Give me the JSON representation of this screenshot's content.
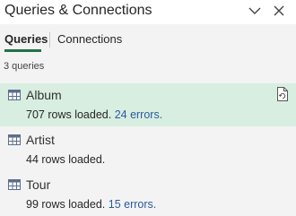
{
  "pane": {
    "title": "Queries & Connections"
  },
  "tabs": [
    {
      "label": "Queries",
      "active": true
    },
    {
      "label": "Connections",
      "active": false
    }
  ],
  "query_count_text": "3 queries",
  "queries": [
    {
      "name": "Album",
      "rows_text": "707 rows loaded.",
      "errors_text": "24 errors.",
      "selected": true
    },
    {
      "name": "Artist",
      "rows_text": "44 rows loaded.",
      "errors_text": "",
      "selected": false
    },
    {
      "name": "Tour",
      "rows_text": "99 rows loaded.",
      "errors_text": "15 errors.",
      "selected": false
    }
  ],
  "colors": {
    "accent": "#217346",
    "selected_bg": "#d8eee0",
    "error_link": "#2a5aa0"
  }
}
